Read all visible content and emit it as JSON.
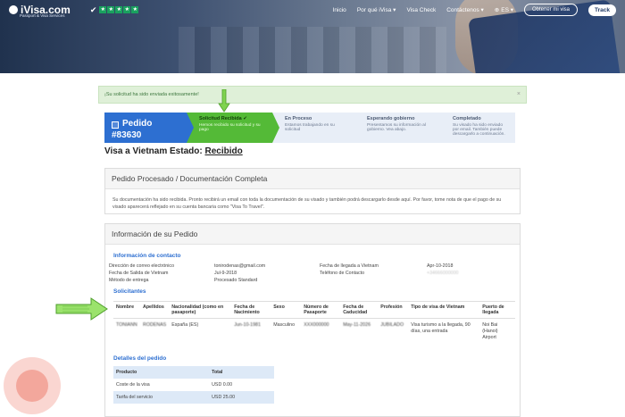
{
  "nav": {
    "logo_text": "iVisa.com",
    "logo_sub": "Passport & Visa Services",
    "stars": [
      "★",
      "★",
      "★",
      "★",
      "★"
    ],
    "links": [
      "Inicio",
      "Por qué iVisa ▾",
      "Visa Check",
      "Contáctenos ▾"
    ],
    "lang": "ES ▾",
    "primary_btn": "Obtener mi visa",
    "track_btn": "Track"
  },
  "alert": {
    "message": "¡Su solicitud ha sido enviada exitosamente!",
    "close": "×"
  },
  "steps": [
    {
      "title": "Pedido",
      "number": "#83630"
    },
    {
      "title": "Solicitud Recibida ✔",
      "desc": "Hemos recibido su solicitud y su pago"
    },
    {
      "title": "En Proceso",
      "desc": "Estamos trabajando en su solicitud"
    },
    {
      "title": "Esperando gobierno",
      "desc": "Presentamos su información al gobierno. Vea abajo."
    },
    {
      "title": "Completado",
      "desc": "Su visado ha sido enviado por email. También puede descargarlo a continuación."
    }
  ],
  "status": {
    "prefix": "Visa a Vietnam Estado:",
    "value": "Recibido"
  },
  "card1": {
    "title": "Pedido Procesado / Documentación Completa",
    "body": "Su documentación ha sido recibida. Pronto recibirá un email con toda la documentación de su visado y también podrá descargarlo desde aquí. Por favor, tome nota de que el pago de su visado aparecerá reflejado en su cuenta bancaria como \"Visa To Travel\"."
  },
  "card2": {
    "title": "Información de su Pedido"
  },
  "contact": {
    "title": "Información de contacto",
    "left_labels": [
      "Dirección de correo electrónico",
      "Fecha de Salida de Vietnam",
      "Método de entrega"
    ],
    "left_values": [
      "tonirodenas@gmail.com",
      "Jul-9-2018",
      "Procesado Standard"
    ],
    "right_labels": [
      "Fecha de llegada a Vietnam",
      "Teléfono de Contacto"
    ],
    "right_values": [
      "Apr-10-2018",
      "+34666000000"
    ]
  },
  "applicants": {
    "title": "Solicitantes",
    "headers": [
      "Nombre",
      "Apellidos",
      "Nacionalidad (como en pasaporte)",
      "Fecha de Nacimiento",
      "Sexo",
      "Número de Pasaporte",
      "Fecha de Caducidad",
      "Profesión",
      "Tipo de visa de Vietnam",
      "Puerto de llegada"
    ],
    "row": [
      "TONIANN",
      "RODENAS",
      "España (ES)",
      "Jun-10-1981",
      "Masculino",
      "XXX000000",
      "May-11-2026",
      "JUBILADO",
      "Visa turismo a la llegada, 90 días, una entrada",
      "Noi Bai (Hanoi) Airport"
    ]
  },
  "order": {
    "title": "Detalles del pedido",
    "headers": [
      "Producto",
      "Total"
    ],
    "rows": [
      [
        "Coste de la visa",
        "USD 0.00"
      ],
      [
        "Tarifa del servicio",
        "USD 25.00"
      ]
    ]
  }
}
